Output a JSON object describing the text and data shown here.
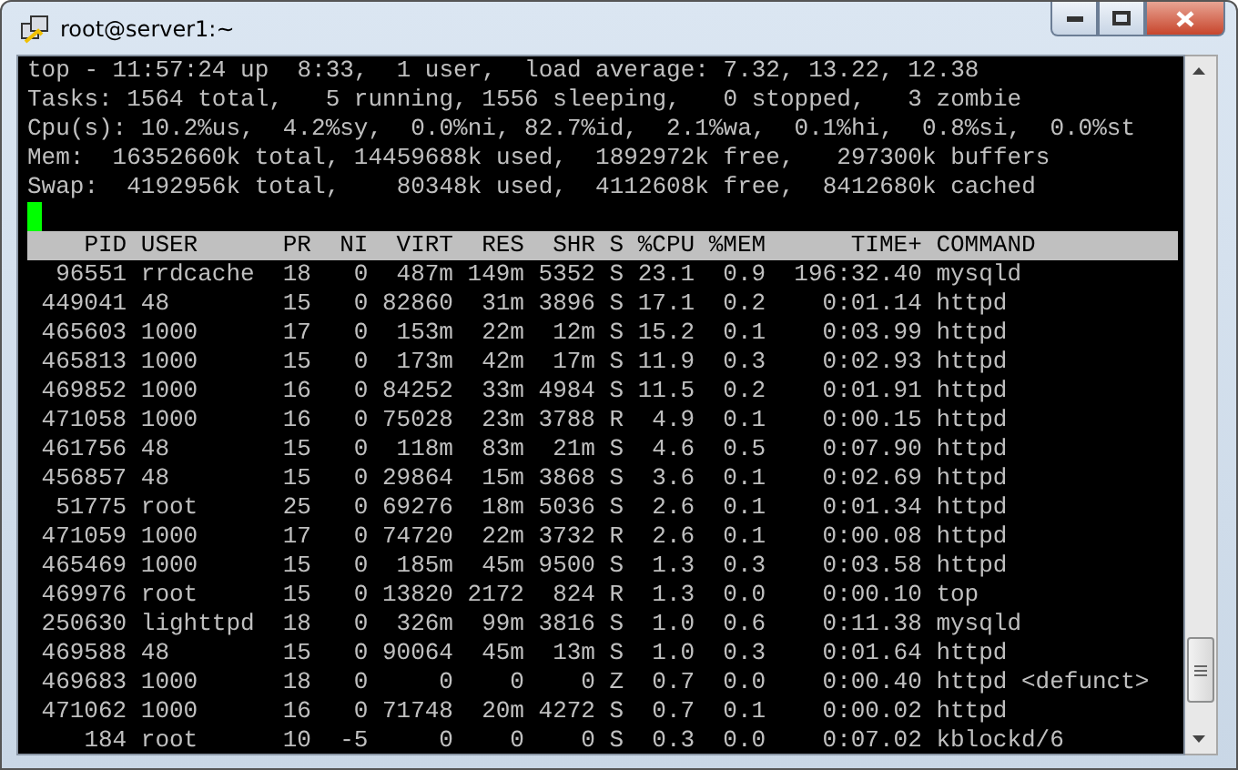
{
  "window": {
    "title": "root@server1:~"
  },
  "summary": [
    "top - 11:57:24 up  8:33,  1 user,  load average: 7.32, 13.22, 12.38",
    "Tasks: 1564 total,   5 running, 1556 sleeping,   0 stopped,   3 zombie",
    "Cpu(s): 10.2%us,  4.2%sy,  0.0%ni, 82.7%id,  2.1%wa,  0.1%hi,  0.8%si,  0.0%st",
    "Mem:  16352660k total, 14459688k used,  1892972k free,   297300k buffers",
    "Swap:  4192956k total,    80348k used,  4112608k free,  8412680k cached"
  ],
  "cursor": {
    "visible": true
  },
  "table": {
    "columns": [
      "PID",
      "USER",
      "PR",
      "NI",
      "VIRT",
      "RES",
      "SHR",
      "S",
      "%CPU",
      "%MEM",
      "TIME+",
      "COMMAND"
    ],
    "rows": [
      [
        "96551",
        "rrdcache",
        "18",
        "0",
        "487m",
        "149m",
        "5352",
        "S",
        "23.1",
        "0.9",
        "196:32.40",
        "mysqld"
      ],
      [
        "449041",
        "48",
        "15",
        "0",
        "82860",
        "31m",
        "3896",
        "S",
        "17.1",
        "0.2",
        "0:01.14",
        "httpd"
      ],
      [
        "465603",
        "1000",
        "17",
        "0",
        "153m",
        "22m",
        "12m",
        "S",
        "15.2",
        "0.1",
        "0:03.99",
        "httpd"
      ],
      [
        "465813",
        "1000",
        "15",
        "0",
        "173m",
        "42m",
        "17m",
        "S",
        "11.9",
        "0.3",
        "0:02.93",
        "httpd"
      ],
      [
        "469852",
        "1000",
        "16",
        "0",
        "84252",
        "33m",
        "4984",
        "S",
        "11.5",
        "0.2",
        "0:01.91",
        "httpd"
      ],
      [
        "471058",
        "1000",
        "16",
        "0",
        "75028",
        "23m",
        "3788",
        "R",
        "4.9",
        "0.1",
        "0:00.15",
        "httpd"
      ],
      [
        "461756",
        "48",
        "15",
        "0",
        "118m",
        "83m",
        "21m",
        "S",
        "4.6",
        "0.5",
        "0:07.90",
        "httpd"
      ],
      [
        "456857",
        "48",
        "15",
        "0",
        "29864",
        "15m",
        "3868",
        "S",
        "3.6",
        "0.1",
        "0:02.69",
        "httpd"
      ],
      [
        "51775",
        "root",
        "25",
        "0",
        "69276",
        "18m",
        "5036",
        "S",
        "2.6",
        "0.1",
        "0:01.34",
        "httpd"
      ],
      [
        "471059",
        "1000",
        "17",
        "0",
        "74720",
        "22m",
        "3732",
        "R",
        "2.6",
        "0.1",
        "0:00.08",
        "httpd"
      ],
      [
        "465469",
        "1000",
        "15",
        "0",
        "185m",
        "45m",
        "9500",
        "S",
        "1.3",
        "0.3",
        "0:03.58",
        "httpd"
      ],
      [
        "469976",
        "root",
        "15",
        "0",
        "13820",
        "2172",
        "824",
        "R",
        "1.3",
        "0.0",
        "0:00.10",
        "top"
      ],
      [
        "250630",
        "lighttpd",
        "18",
        "0",
        "326m",
        "99m",
        "3816",
        "S",
        "1.0",
        "0.6",
        "0:11.38",
        "mysqld"
      ],
      [
        "469588",
        "48",
        "15",
        "0",
        "90064",
        "45m",
        "13m",
        "S",
        "1.0",
        "0.3",
        "0:01.64",
        "httpd"
      ],
      [
        "469683",
        "1000",
        "18",
        "0",
        "0",
        "0",
        "0",
        "Z",
        "0.7",
        "0.0",
        "0:00.40",
        "httpd <defunct>"
      ],
      [
        "471062",
        "1000",
        "16",
        "0",
        "71748",
        "20m",
        "4272",
        "S",
        "0.7",
        "0.1",
        "0:00.02",
        "httpd"
      ],
      [
        "184",
        "root",
        "10",
        "-5",
        "0",
        "0",
        "0",
        "S",
        "0.3",
        "0.0",
        "0:07.02",
        "kblockd/6"
      ]
    ]
  }
}
